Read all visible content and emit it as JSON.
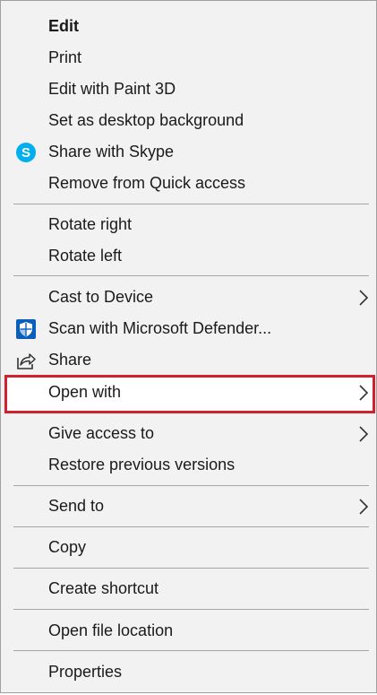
{
  "menu": {
    "items": [
      {
        "label": "Edit",
        "bold": true
      },
      {
        "label": "Print"
      },
      {
        "label": "Edit with Paint 3D"
      },
      {
        "label": "Set as desktop background"
      },
      {
        "label": "Share with Skype",
        "icon": "skype-icon"
      },
      {
        "label": "Remove from Quick access"
      },
      {
        "label": "Rotate right"
      },
      {
        "label": "Rotate left"
      },
      {
        "label": "Cast to Device",
        "submenu": true
      },
      {
        "label": "Scan with Microsoft Defender...",
        "icon": "defender-shield-icon"
      },
      {
        "label": "Share",
        "icon": "share-icon"
      },
      {
        "label": "Open with",
        "submenu": true,
        "highlighted": true
      },
      {
        "label": "Give access to",
        "submenu": true
      },
      {
        "label": "Restore previous versions"
      },
      {
        "label": "Send to",
        "submenu": true
      },
      {
        "label": "Copy"
      },
      {
        "label": "Create shortcut"
      },
      {
        "label": "Open file location"
      },
      {
        "label": "Properties"
      }
    ],
    "skype_letter": "S"
  },
  "colors": {
    "menu_background": "#f2f2f2",
    "highlight_border": "#d2202f",
    "skype_blue": "#00aff0",
    "defender_blue": "#0a5ebc",
    "separator": "#a6a6a6"
  }
}
